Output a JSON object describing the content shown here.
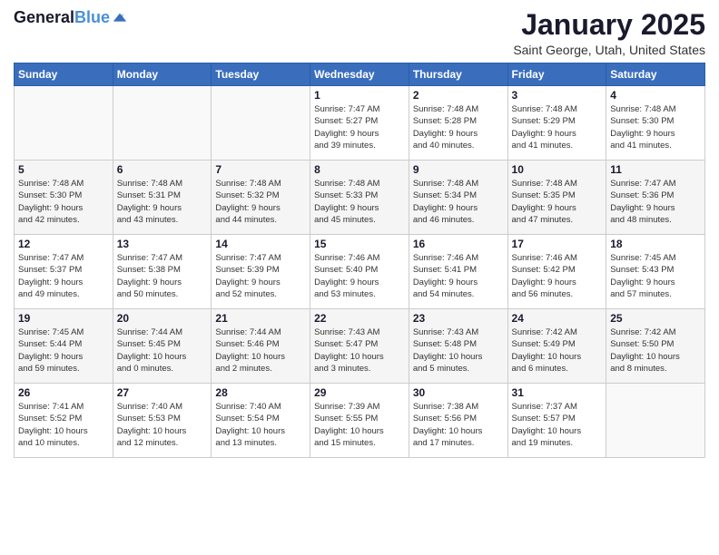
{
  "header": {
    "logo_line1": "General",
    "logo_line2": "Blue",
    "month": "January 2025",
    "location": "Saint George, Utah, United States"
  },
  "weekdays": [
    "Sunday",
    "Monday",
    "Tuesday",
    "Wednesday",
    "Thursday",
    "Friday",
    "Saturday"
  ],
  "weeks": [
    [
      {
        "day": "",
        "info": ""
      },
      {
        "day": "",
        "info": ""
      },
      {
        "day": "",
        "info": ""
      },
      {
        "day": "1",
        "info": "Sunrise: 7:47 AM\nSunset: 5:27 PM\nDaylight: 9 hours\nand 39 minutes."
      },
      {
        "day": "2",
        "info": "Sunrise: 7:48 AM\nSunset: 5:28 PM\nDaylight: 9 hours\nand 40 minutes."
      },
      {
        "day": "3",
        "info": "Sunrise: 7:48 AM\nSunset: 5:29 PM\nDaylight: 9 hours\nand 41 minutes."
      },
      {
        "day": "4",
        "info": "Sunrise: 7:48 AM\nSunset: 5:30 PM\nDaylight: 9 hours\nand 41 minutes."
      }
    ],
    [
      {
        "day": "5",
        "info": "Sunrise: 7:48 AM\nSunset: 5:30 PM\nDaylight: 9 hours\nand 42 minutes."
      },
      {
        "day": "6",
        "info": "Sunrise: 7:48 AM\nSunset: 5:31 PM\nDaylight: 9 hours\nand 43 minutes."
      },
      {
        "day": "7",
        "info": "Sunrise: 7:48 AM\nSunset: 5:32 PM\nDaylight: 9 hours\nand 44 minutes."
      },
      {
        "day": "8",
        "info": "Sunrise: 7:48 AM\nSunset: 5:33 PM\nDaylight: 9 hours\nand 45 minutes."
      },
      {
        "day": "9",
        "info": "Sunrise: 7:48 AM\nSunset: 5:34 PM\nDaylight: 9 hours\nand 46 minutes."
      },
      {
        "day": "10",
        "info": "Sunrise: 7:48 AM\nSunset: 5:35 PM\nDaylight: 9 hours\nand 47 minutes."
      },
      {
        "day": "11",
        "info": "Sunrise: 7:47 AM\nSunset: 5:36 PM\nDaylight: 9 hours\nand 48 minutes."
      }
    ],
    [
      {
        "day": "12",
        "info": "Sunrise: 7:47 AM\nSunset: 5:37 PM\nDaylight: 9 hours\nand 49 minutes."
      },
      {
        "day": "13",
        "info": "Sunrise: 7:47 AM\nSunset: 5:38 PM\nDaylight: 9 hours\nand 50 minutes."
      },
      {
        "day": "14",
        "info": "Sunrise: 7:47 AM\nSunset: 5:39 PM\nDaylight: 9 hours\nand 52 minutes."
      },
      {
        "day": "15",
        "info": "Sunrise: 7:46 AM\nSunset: 5:40 PM\nDaylight: 9 hours\nand 53 minutes."
      },
      {
        "day": "16",
        "info": "Sunrise: 7:46 AM\nSunset: 5:41 PM\nDaylight: 9 hours\nand 54 minutes."
      },
      {
        "day": "17",
        "info": "Sunrise: 7:46 AM\nSunset: 5:42 PM\nDaylight: 9 hours\nand 56 minutes."
      },
      {
        "day": "18",
        "info": "Sunrise: 7:45 AM\nSunset: 5:43 PM\nDaylight: 9 hours\nand 57 minutes."
      }
    ],
    [
      {
        "day": "19",
        "info": "Sunrise: 7:45 AM\nSunset: 5:44 PM\nDaylight: 9 hours\nand 59 minutes."
      },
      {
        "day": "20",
        "info": "Sunrise: 7:44 AM\nSunset: 5:45 PM\nDaylight: 10 hours\nand 0 minutes."
      },
      {
        "day": "21",
        "info": "Sunrise: 7:44 AM\nSunset: 5:46 PM\nDaylight: 10 hours\nand 2 minutes."
      },
      {
        "day": "22",
        "info": "Sunrise: 7:43 AM\nSunset: 5:47 PM\nDaylight: 10 hours\nand 3 minutes."
      },
      {
        "day": "23",
        "info": "Sunrise: 7:43 AM\nSunset: 5:48 PM\nDaylight: 10 hours\nand 5 minutes."
      },
      {
        "day": "24",
        "info": "Sunrise: 7:42 AM\nSunset: 5:49 PM\nDaylight: 10 hours\nand 6 minutes."
      },
      {
        "day": "25",
        "info": "Sunrise: 7:42 AM\nSunset: 5:50 PM\nDaylight: 10 hours\nand 8 minutes."
      }
    ],
    [
      {
        "day": "26",
        "info": "Sunrise: 7:41 AM\nSunset: 5:52 PM\nDaylight: 10 hours\nand 10 minutes."
      },
      {
        "day": "27",
        "info": "Sunrise: 7:40 AM\nSunset: 5:53 PM\nDaylight: 10 hours\nand 12 minutes."
      },
      {
        "day": "28",
        "info": "Sunrise: 7:40 AM\nSunset: 5:54 PM\nDaylight: 10 hours\nand 13 minutes."
      },
      {
        "day": "29",
        "info": "Sunrise: 7:39 AM\nSunset: 5:55 PM\nDaylight: 10 hours\nand 15 minutes."
      },
      {
        "day": "30",
        "info": "Sunrise: 7:38 AM\nSunset: 5:56 PM\nDaylight: 10 hours\nand 17 minutes."
      },
      {
        "day": "31",
        "info": "Sunrise: 7:37 AM\nSunset: 5:57 PM\nDaylight: 10 hours\nand 19 minutes."
      },
      {
        "day": "",
        "info": ""
      }
    ]
  ]
}
